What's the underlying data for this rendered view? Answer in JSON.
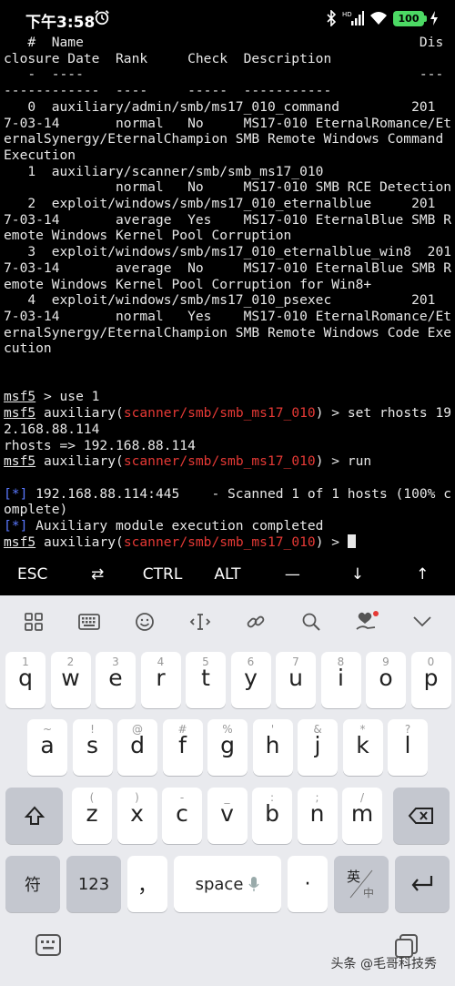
{
  "status": {
    "time": "下午3:58",
    "battery": "100"
  },
  "terminal": {
    "lines": [
      "   #  Name                                          Dis",
      "closure Date  Rank     Check  Description",
      "   -  ----                                          ---",
      "------------  ----     -----  -----------",
      "   0  auxiliary/admin/smb/ms17_010_command         201",
      "7-03-14       normal   No     MS17-010 EternalRomance/Et",
      "ernalSynergy/EternalChampion SMB Remote Windows Command",
      "Execution",
      "   1  auxiliary/scanner/smb/smb_ms17_010",
      "              normal   No     MS17-010 SMB RCE Detection",
      "   2  exploit/windows/smb/ms17_010_eternalblue     201",
      "7-03-14       average  Yes    MS17-010 EternalBlue SMB R",
      "emote Windows Kernel Pool Corruption",
      "   3  exploit/windows/smb/ms17_010_eternalblue_win8  201",
      "7-03-14       average  No     MS17-010 EternalBlue SMB R",
      "emote Windows Kernel Pool Corruption for Win8+",
      "   4  exploit/windows/smb/ms17_010_psexec          201",
      "7-03-14       normal   Yes    MS17-010 EternalRomance/Et",
      "ernalSynergy/EternalChampion SMB Remote Windows Code Exe",
      "cution"
    ],
    "prompt_base": "msf5",
    "cmd1": " > use 1",
    "aux_open": " auxiliary(",
    "module": "scanner/smb/smb_ms17_010",
    "aux_close": ")",
    "cmd2_a": " > set rhosts 19",
    "cmd2_b": "2.168.88.114",
    "rhosts_out": "rhosts => 192.168.88.114",
    "cmd3": " > run",
    "star": "[*]",
    "scan_a": " 192.168.88.114:445    - Scanned 1 of 1 hosts (100% c",
    "scan_b": "omplete)",
    "done": " Auxiliary module execution completed",
    "final": " > "
  },
  "extra_keys": [
    "ESC",
    "⇄",
    "CTRL",
    "ALT",
    "—",
    "↓",
    "↑"
  ],
  "keyboard": {
    "row1": [
      [
        "1",
        "q"
      ],
      [
        "2",
        "w"
      ],
      [
        "3",
        "e"
      ],
      [
        "4",
        "r"
      ],
      [
        "5",
        "t"
      ],
      [
        "6",
        "y"
      ],
      [
        "7",
        "u"
      ],
      [
        "8",
        "i"
      ],
      [
        "9",
        "o"
      ],
      [
        "0",
        "p"
      ]
    ],
    "row2": [
      [
        "~",
        "a"
      ],
      [
        "!",
        "s"
      ],
      [
        "@",
        "d"
      ],
      [
        "#",
        "f"
      ],
      [
        "%",
        "g"
      ],
      [
        "'",
        "h"
      ],
      [
        "&",
        "j"
      ],
      [
        "*",
        "k"
      ],
      [
        "?",
        "l"
      ]
    ],
    "row3": [
      [
        "(",
        "z"
      ],
      [
        ")",
        "x"
      ],
      [
        "-",
        "c"
      ],
      [
        "_",
        "v"
      ],
      [
        ":",
        "b"
      ],
      [
        ";",
        "n"
      ],
      [
        "/",
        "m"
      ]
    ],
    "sym": "符",
    "num": "123",
    "comma": "，",
    "space": "space",
    "period": "·",
    "lang_main": "英",
    "lang_sub": "中",
    "watermark": "头条 @毛哥科技秀"
  }
}
